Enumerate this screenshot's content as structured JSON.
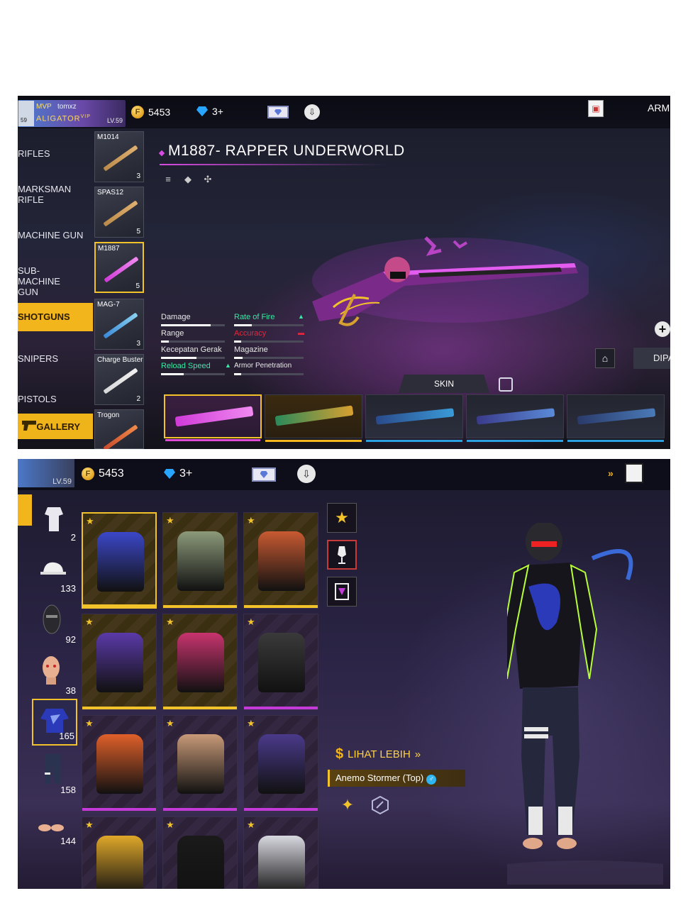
{
  "weapon_screen": {
    "player": {
      "mvp": "MVP",
      "name": "tomxz",
      "guild": "ALIGATOR",
      "guild_tag": "VIP",
      "level": "LV.59",
      "avatar_level": "59"
    },
    "currency": {
      "gold": "5453",
      "diamonds": "3+"
    },
    "top_right": "ARM",
    "categories": [
      {
        "label": "RIFLES",
        "active": false
      },
      {
        "label": "MARKSMAN RIFLE",
        "active": false
      },
      {
        "label": "MACHINE GUN",
        "active": false
      },
      {
        "label": "SUB-MACHINE GUN",
        "active": false
      },
      {
        "label": "SHOTGUNS",
        "active": true
      },
      {
        "label": "SNIPERS",
        "active": false
      },
      {
        "label": "PISTOLS",
        "active": false
      }
    ],
    "gallery_label": "GALLERY",
    "weapons": [
      {
        "name": "M1014",
        "count": "3",
        "active": false
      },
      {
        "name": "SPAS12",
        "count": "5",
        "active": false
      },
      {
        "name": "M1887",
        "count": "5",
        "active": true
      },
      {
        "name": "MAG-7",
        "count": "3",
        "active": false
      },
      {
        "name": "Charge Buster",
        "count": "2",
        "active": false
      },
      {
        "name": "Trogon",
        "count": "",
        "active": false
      }
    ],
    "title": "M1887- RAPPER UNDERWORLD",
    "stats": {
      "damage": {
        "label": "Damage",
        "value": 0.78
      },
      "rate_of_fire": {
        "label": "Rate of Fire",
        "value": 0.25
      },
      "range": {
        "label": "Range",
        "value": 0.12
      },
      "accuracy": {
        "label": "Accuracy",
        "value": 0.1
      },
      "movement_speed": {
        "label": "Kecepatan Gerak",
        "value": 0.55
      },
      "magazine": {
        "label": "Magazine",
        "value": 0.12
      },
      "reload_speed": {
        "label": "Reload Speed",
        "value": 0.35
      },
      "armor_penetration": {
        "label": "Armor Penetration",
        "value": 0.1
      }
    },
    "skin_tab": "SKIN",
    "equip_label": "DIPA",
    "colors": {
      "accent": "#f2b51c",
      "title_accent": "#d64be0",
      "stat_up": "#38e8a4",
      "stat_down": "#e8263c"
    }
  },
  "outfit_screen": {
    "level": "LV.59",
    "currency": {
      "gold": "5453",
      "diamonds": "3+"
    },
    "categories": [
      {
        "count": "2",
        "icon": "outfit-set-icon"
      },
      {
        "count": "133",
        "icon": "cap-icon"
      },
      {
        "count": "92",
        "icon": "mask-icon"
      },
      {
        "count": "38",
        "icon": "face-icon"
      },
      {
        "count": "165",
        "icon": "top-icon",
        "active": true
      },
      {
        "count": "158",
        "icon": "pants-icon"
      },
      {
        "count": "144",
        "icon": "shoes-icon"
      }
    ],
    "items": [
      {
        "rarity": "gold",
        "color": "#3b47c8",
        "selected": true
      },
      {
        "rarity": "gold",
        "color": "#8c9a7a"
      },
      {
        "rarity": "gold",
        "color": "#c85a32"
      },
      {
        "rarity": "gold",
        "color": "#5a3aa8"
      },
      {
        "rarity": "gold",
        "color": "#c8346e"
      },
      {
        "rarity": "purple",
        "color": "#3a3a3a"
      },
      {
        "rarity": "purple",
        "color": "#e0602a"
      },
      {
        "rarity": "purple",
        "color": "#c89a78"
      },
      {
        "rarity": "purple",
        "color": "#4a3a8a"
      },
      {
        "rarity": "purple",
        "color": "#e0a82a"
      },
      {
        "rarity": "purple",
        "color": "#1a1a1a"
      },
      {
        "rarity": "purple",
        "color": "#d8d8e0"
      }
    ],
    "see_more": "LIHAT LEBIH",
    "item_name": "Anemo Stormer (Top)",
    "colors": {
      "gold_rarity": "#f2c22a",
      "purple_rarity": "#c43ad8"
    }
  }
}
